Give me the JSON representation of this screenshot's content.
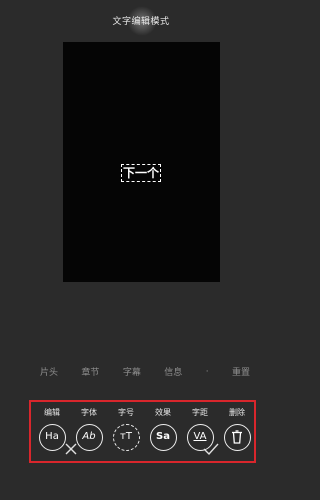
{
  "header": {
    "title": "文字编辑模式"
  },
  "canvas": {
    "overlay_text": "下一个"
  },
  "sections": [
    "片头",
    "章节",
    "字幕",
    "信息",
    "重置"
  ],
  "sections_separator": "·",
  "tools": [
    {
      "label": "编辑",
      "icon": "edit-text-icon",
      "glyph": "Ha"
    },
    {
      "label": "字体",
      "icon": "font-icon",
      "glyph": "Ab"
    },
    {
      "label": "字号",
      "icon": "font-size-icon",
      "glyph": "ᴛT"
    },
    {
      "label": "效果",
      "icon": "effect-icon",
      "glyph": "Sa"
    },
    {
      "label": "字距",
      "icon": "letter-spacing-icon",
      "glyph": "VA"
    },
    {
      "label": "删除",
      "icon": "trash-icon",
      "glyph": ""
    }
  ],
  "colors": {
    "background": "#2b2b2b",
    "highlight_border": "#d9262c",
    "text": "#e8e8e8"
  },
  "footer": {
    "cancel_icon": "close-icon",
    "confirm_icon": "check-icon"
  }
}
